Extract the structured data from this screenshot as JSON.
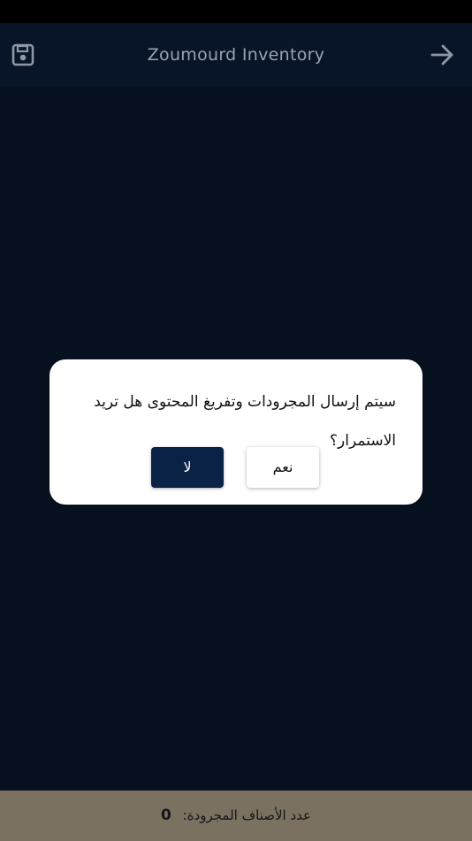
{
  "header": {
    "title": "Zoumourd Inventory",
    "left_icon": "save-icon",
    "right_icon": "arrow-right-icon"
  },
  "dialog": {
    "message": "سيتم إرسال المجرودات وتفريغ المحتوى هل تريد الاستمرار؟",
    "no_label": "لا",
    "yes_label": "نعم"
  },
  "footer": {
    "label": "عدد الأصناف المجرودة:",
    "count": "0"
  },
  "colors": {
    "background": "#06101f",
    "header": "#081427",
    "primary_button": "#0b2247",
    "footer": "#7a7160"
  }
}
